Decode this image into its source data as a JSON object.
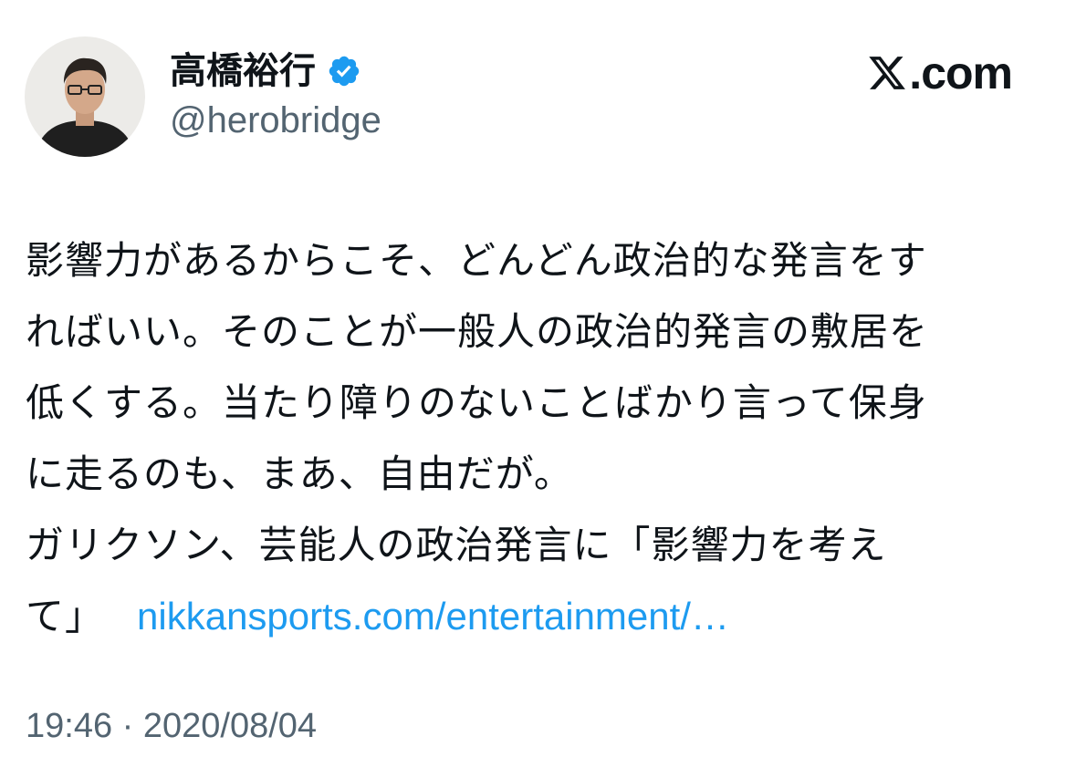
{
  "author": {
    "display_name": "高橋裕行",
    "handle": "@herobridge",
    "verified_icon": "verified-badge-icon",
    "avatar_icon": "profile-photo"
  },
  "brand": {
    "logo_icon": "x-logo-icon",
    "logo_text": ".com"
  },
  "tweet": {
    "lines": [
      "影響力があるからこそ、どんどん政治的な発言をす",
      "ればいい。そのことが一般人の政治的発言の敷居を",
      "低くする。当たり障りのないことばかり言って保身",
      "に走るのも、まあ、自由だが。",
      "ガリクソン、芸能人の政治発言に「影響力を考え"
    ],
    "last_line_text": "て」",
    "link_text": "nikkansports.com/entertainment/…",
    "timestamp": "19:46 · 2020/08/04"
  },
  "colors": {
    "link": "#1d9bf0",
    "secondary_text": "#536471",
    "primary_text": "#0f1419",
    "verified": "#1d9bf0"
  }
}
